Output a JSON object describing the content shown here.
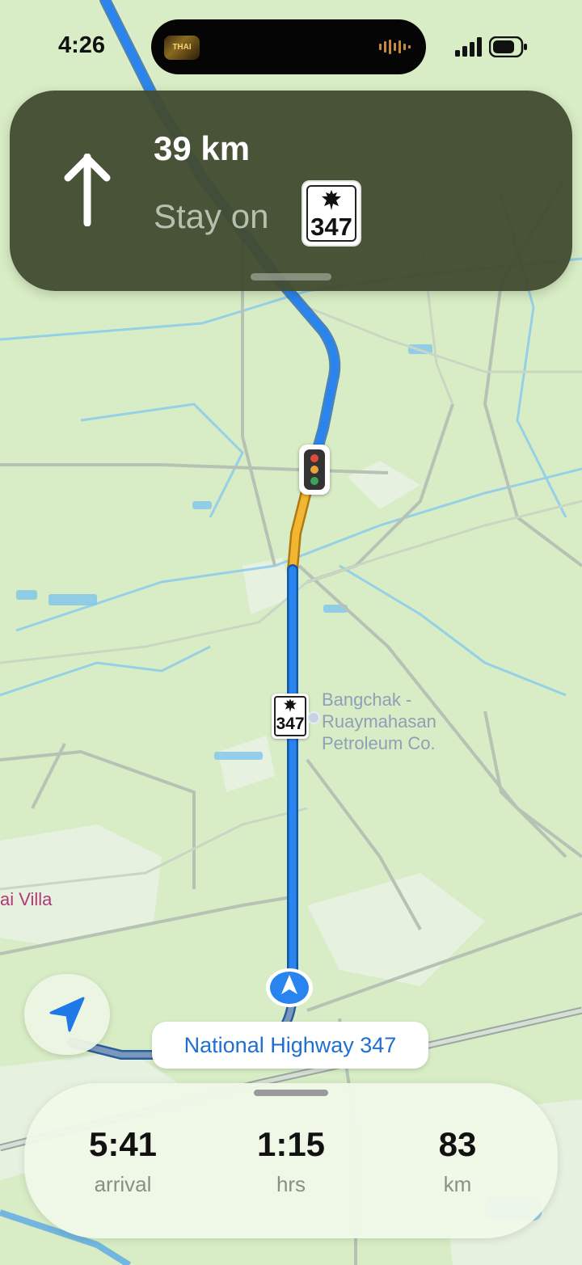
{
  "status_bar": {
    "time": "4:26",
    "now_playing_art": "THAI R&B"
  },
  "navigation": {
    "distance": "39 km",
    "instruction": "Stay on",
    "route_shield": "347"
  },
  "map": {
    "route_shield": "347",
    "poi_lines": [
      "Bangchak -",
      "Ruaymahasan",
      "Petroleum Co."
    ],
    "place_label": "ai Villa",
    "current_road": "National Highway 347"
  },
  "trip": {
    "arrival_value": "5:41",
    "arrival_label": "arrival",
    "duration_value": "1:15",
    "duration_label": "hrs",
    "distance_value": "83",
    "distance_label": "km"
  },
  "icons": {
    "recenter": "location-arrow-icon",
    "maneuver": "arrow-up-icon",
    "traffic": "traffic-light-icon"
  },
  "colors": {
    "route": "#1e7df2",
    "route_slow": "#f2b632",
    "banner": "#424c32",
    "accent_text": "#1f6fd1"
  }
}
